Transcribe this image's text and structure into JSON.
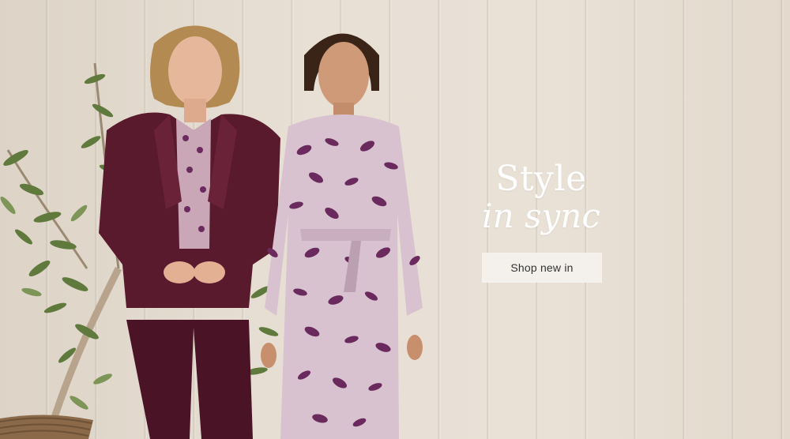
{
  "hero": {
    "headline_line1": "Style",
    "headline_line2": "in sync",
    "cta_label": "Shop new in"
  },
  "colors": {
    "background": "#e6ddd2",
    "headline": "#ffffff",
    "cta_background": "#f4f1ed",
    "cta_text": "#333333",
    "velvet_plum": "#4a1426",
    "print_purple": "#6b2a5e"
  }
}
